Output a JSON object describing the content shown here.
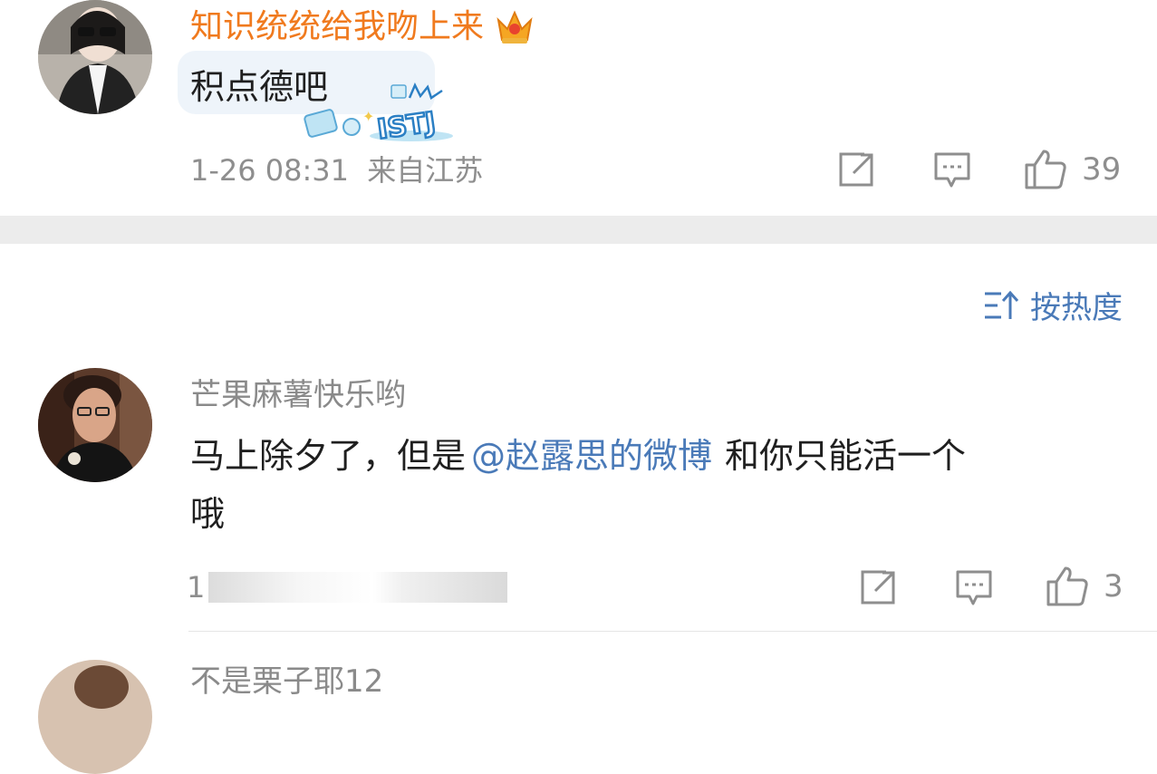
{
  "comments": [
    {
      "author": "知识统统给我吻上来",
      "author_color": "#f07a1e",
      "badge_icon": "crown-icon",
      "text": "积点德吧",
      "sticker": "ISTJ",
      "time": "1-26 08:31",
      "location": "来自江苏",
      "likes": "39"
    },
    {
      "author": "芒果麻薯快乐哟",
      "text_before": "马上除夕了，但是",
      "mention": "@赵露思的微博",
      "text_after": "和你只能活一个",
      "text_line2": "哦",
      "time_partial": "1",
      "likes": "3"
    },
    {
      "author_partial": "不是栗子耶12"
    }
  ],
  "sort_label": "按热度",
  "colors": {
    "accent": "#4a7ab8",
    "meta_gray": "#8e8e8e",
    "separator": "#ececec"
  }
}
